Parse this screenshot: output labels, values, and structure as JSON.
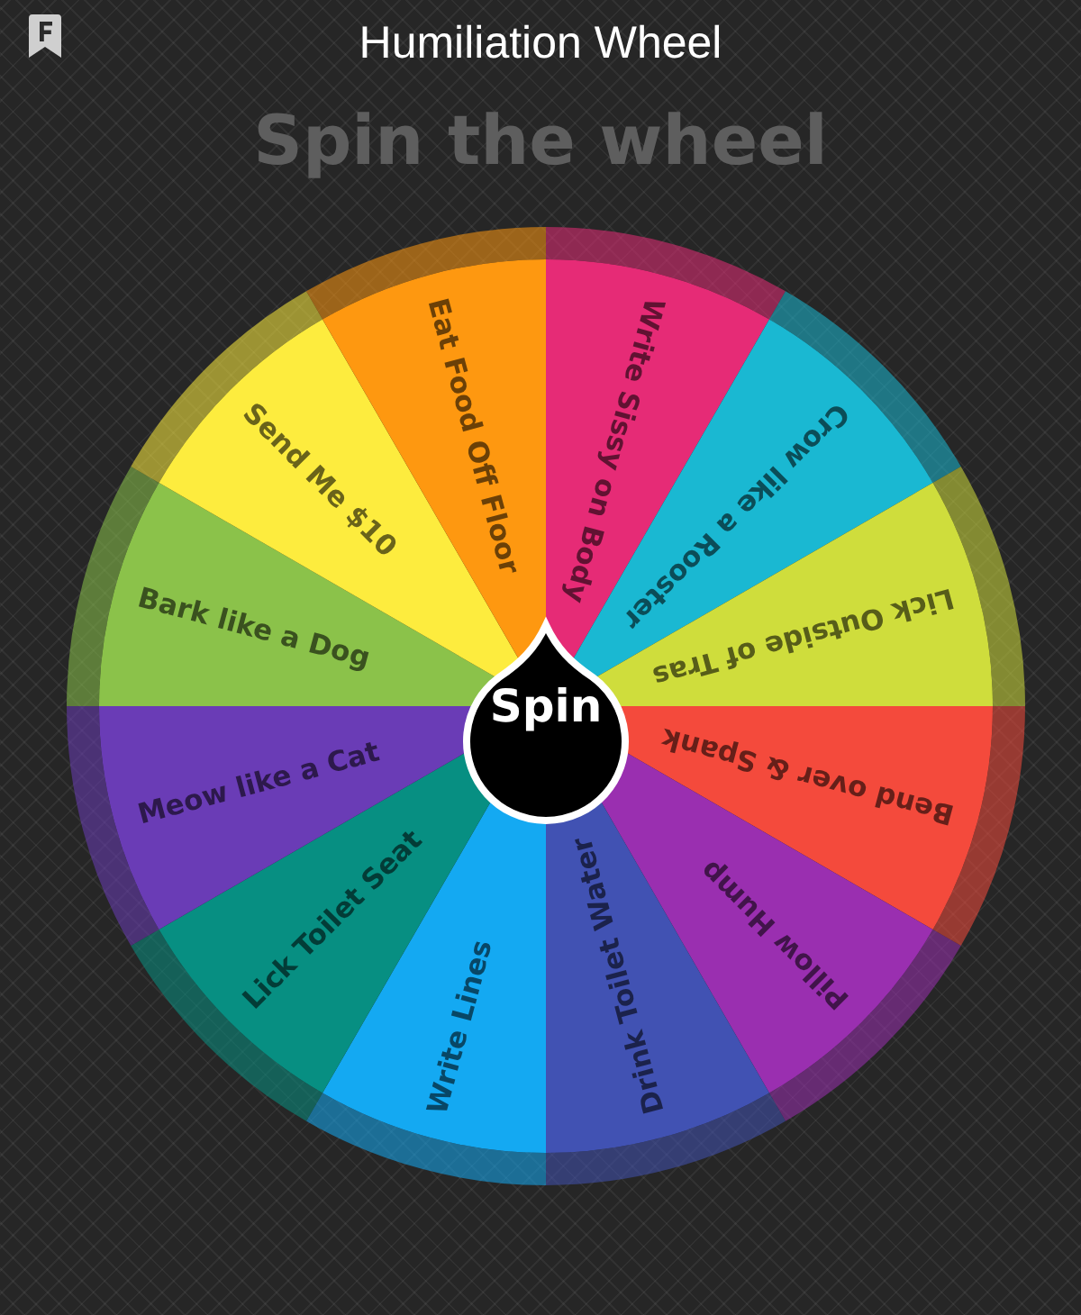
{
  "header": {
    "title": "Humiliation Wheel"
  },
  "heading": "Spin the wheel",
  "wheel": {
    "segments": [
      {
        "label": "Write Sissy on Body",
        "color": "#e62b76"
      },
      {
        "label": "Crow like a Rooster",
        "color": "#1ab8d2"
      },
      {
        "label": "Lick Outside of Tras",
        "color": "#cfdd3c"
      },
      {
        "label": "Bend over & Spank",
        "color": "#f44a3c"
      },
      {
        "label": "Pillow Hump",
        "color": "#9a2fb0"
      },
      {
        "label": "Drink Toilet Water",
        "color": "#4152b3"
      },
      {
        "label": "Write Lines",
        "color": "#14a9f2"
      },
      {
        "label": "Lick Toilet Seat",
        "color": "#078f82"
      },
      {
        "label": "Meow like a Cat",
        "color": "#6a3cb6"
      },
      {
        "label": "Bark like a Dog",
        "color": "#8bc24a"
      },
      {
        "label": "Send Me $10",
        "color": "#fdec3e"
      },
      {
        "label": "Eat Food Off Floor",
        "color": "#fe9810"
      }
    ]
  },
  "spin_button": "Spin"
}
